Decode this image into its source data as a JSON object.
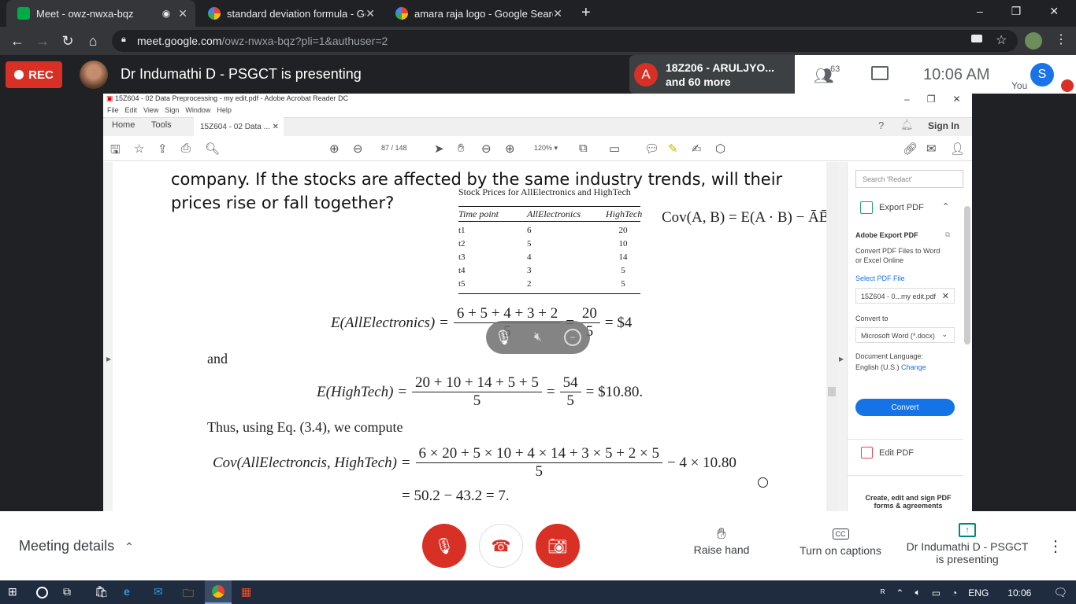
{
  "browser": {
    "tabs": [
      {
        "title": "Meet - owz-nwxa-bqz",
        "favicon": "meet-icon",
        "color": "#00ac47"
      },
      {
        "title": "standard deviation formula - Goo",
        "favicon": "google-icon",
        "color": "#4285f4"
      },
      {
        "title": "amara raja logo - Google Search",
        "favicon": "google-icon",
        "color": "#4285f4"
      }
    ],
    "new_tab": "+",
    "url_host": "meet.google.com",
    "url_path": "/owz-nwxa-bqz?pli=1&authuser=2",
    "window_controls": [
      "–",
      "❐",
      "✕"
    ]
  },
  "meet_top": {
    "rec_label": "REC",
    "presenter_text": "Dr Indumathi D - PSGCT is presenting",
    "participant_initial": "A",
    "participant_name": "18Z206 - ARULJYO...",
    "participant_more": "and 60 more",
    "people_count": "63",
    "time": "10:06  AM",
    "you_initial": "S",
    "you_label": "You"
  },
  "acrobat": {
    "title": "15Z604 - 02 Data Preprocessing - my edit.pdf - Adobe Acrobat Reader DC",
    "menu": [
      "File",
      "Edit",
      "View",
      "Sign",
      "Window",
      "Help"
    ],
    "tabs": {
      "home": "Home",
      "tools": "Tools",
      "doc": "15Z604 - 02 Data ..."
    },
    "sign_in": "Sign In",
    "page_current": "87",
    "page_total": "/ 148",
    "zoom": "120%"
  },
  "document": {
    "question_line1": "company. If the stocks are affected by the same industry trends, will their",
    "question_line2": "prices rise or fall together?",
    "table_caption": "Stock Prices for AllElectronics and HighTech",
    "table_headers": [
      "Time point",
      "AllElectronics",
      "HighTech"
    ],
    "table_rows": [
      [
        "t1",
        "6",
        "20"
      ],
      [
        "t2",
        "5",
        "10"
      ],
      [
        "t3",
        "4",
        "14"
      ],
      [
        "t4",
        "3",
        "5"
      ],
      [
        "t5",
        "2",
        "5"
      ]
    ],
    "cov_formula": "Cov(A, B) = E(A · B) − ĀB̄.",
    "e_all_lhs": "E(AllElectronics) =",
    "e_all_num": "6 + 5 + 4 + 3 + 2",
    "e_all_den": "5",
    "e_all_num2": "20",
    "e_all_den2": "5",
    "e_all_result": "= $4",
    "and_text": "and",
    "e_high_lhs": "E(HighTech) =",
    "e_high_num": "20 + 10 + 14 + 5 + 5",
    "e_high_den": "5",
    "e_high_num2": "54",
    "e_high_den2": "5",
    "e_high_result": "= $10.80.",
    "thus_text": "Thus, using Eq. (3.4), we compute",
    "cov_lhs": "Cov(AllElectroncis, HighTech) =",
    "cov_num": "6 × 20 + 5 × 10 + 4 × 14 + 3 × 5 + 2 × 5",
    "cov_den": "5",
    "cov_tail": "− 4 × 10.80",
    "cov_result": "= 50.2 − 43.2 = 7."
  },
  "right_panel": {
    "search_placeholder": "Search 'Redact'",
    "export_pdf": "Export PDF",
    "adobe_export_title": "Adobe Export PDF",
    "adobe_export_desc": "Convert PDF Files to Word or Excel Online",
    "select_file_label": "Select PDF File",
    "selected_file": "15Z604 - 0...my edit.pdf",
    "convert_to_label": "Convert to",
    "convert_to_value": "Microsoft Word (*.docx)",
    "doc_language_label": "Document Language:",
    "doc_language_value": "English (U.S.)",
    "change_link": "Change",
    "convert_button": "Convert",
    "edit_pdf": "Edit PDF",
    "footer": "Create, edit and sign PDF forms & agreements"
  },
  "meet_bottom": {
    "meeting_details": "Meeting details",
    "raise_hand": "Raise hand",
    "captions": "Turn on captions",
    "presenting_line1": "Dr Indumathi D - PSGCT",
    "presenting_line2": "is presenting"
  },
  "taskbar": {
    "language": "ENG",
    "time": "10:06"
  }
}
